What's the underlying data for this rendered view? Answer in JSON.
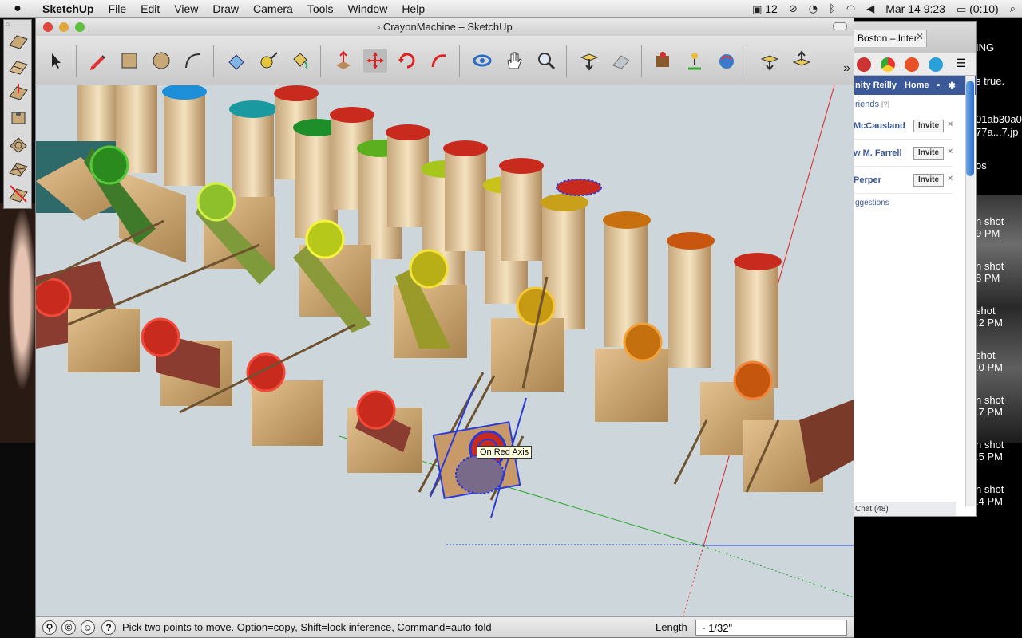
{
  "menubar": {
    "app_name": "SketchUp",
    "items": [
      "File",
      "Edit",
      "View",
      "Draw",
      "Camera",
      "Tools",
      "Window",
      "Help"
    ],
    "status_num": "12",
    "datetime": "Mar 14  9:23",
    "battery": "(0:10)"
  },
  "window": {
    "title": "CrayonMachine – SketchUp"
  },
  "toolbar": {
    "tools": [
      "select-tool",
      "pencil-tool",
      "rectangle-tool",
      "circle-tool",
      "arc-tool",
      "eraser-tool",
      "tape-measure-tool",
      "paint-bucket-tool",
      "push-pull-tool",
      "move-tool",
      "rotate-tool",
      "follow-me-tool",
      "orbit-tool",
      "pan-tool",
      "zoom-tool",
      "get-models-tool",
      "share-model-tool",
      "components-tool",
      "location-tool",
      "google-earth-tool",
      "import-tool",
      "export-tool"
    ]
  },
  "viewport": {
    "tooltip": "On Red Axis"
  },
  "statusbar": {
    "hint": "Pick two points to move.  Option=copy, Shift=lock inference, Command=auto-fold",
    "length_label": "Length",
    "length_value": "~ 1/32\""
  },
  "browser": {
    "tab_title": "Boston – Inter",
    "fb_user": "nity Reilly",
    "fb_home": "Home",
    "friends_header": "riends",
    "friends_hint": "[?]",
    "friends": [
      {
        "name": "McCausland",
        "action": "Invite"
      },
      {
        "name": "w M. Farrell",
        "action": "Invite"
      },
      {
        "name": "Perper",
        "action": "Invite"
      }
    ],
    "suggestions": "ggestions",
    "chat": "Chat (48)"
  },
  "desktop": {
    "labels": [
      "ING",
      "s true.",
      "01ab30a0",
      "77a...7.jp",
      "os",
      "n shot",
      "9 PM",
      "n shot",
      "8 PM",
      "shot",
      ".2 PM",
      "shot",
      ".0 PM",
      "n shot",
      ".7 PM",
      "n shot",
      ".5 PM",
      "n shot",
      ".4 PM"
    ]
  }
}
